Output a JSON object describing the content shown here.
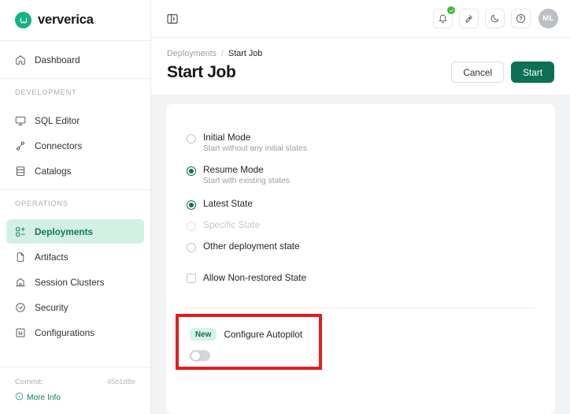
{
  "brand": {
    "name": "ververica",
    "logo_icon": "ververica-logo-icon"
  },
  "sidebar": {
    "top_items": [
      {
        "label": "Dashboard",
        "icon": "home-icon"
      }
    ],
    "sections": [
      {
        "label": "DEVELOPMENT",
        "items": [
          {
            "label": "SQL Editor",
            "icon": "sql-editor-icon"
          },
          {
            "label": "Connectors",
            "icon": "connectors-icon"
          },
          {
            "label": "Catalogs",
            "icon": "catalogs-icon"
          }
        ]
      },
      {
        "label": "OPERATIONS",
        "items": [
          {
            "label": "Deployments",
            "icon": "deployments-icon",
            "active": true
          },
          {
            "label": "Artifacts",
            "icon": "artifacts-icon"
          },
          {
            "label": "Session Clusters",
            "icon": "session-clusters-icon"
          },
          {
            "label": "Security",
            "icon": "security-icon"
          },
          {
            "label": "Configurations",
            "icon": "configurations-icon"
          }
        ]
      }
    ],
    "footer": {
      "commit_label": "Commit:",
      "commit_hash": "45b1d8e",
      "more_info_label": "More Info",
      "more_info_icon": "info-circle-icon"
    }
  },
  "topbar": {
    "collapse_icon": "sidebar-collapse-icon",
    "actions": [
      {
        "name": "notifications",
        "icon": "bell-icon",
        "badge": "check"
      },
      {
        "name": "integrations",
        "icon": "plug-icon"
      },
      {
        "name": "theme-toggle",
        "icon": "moon-icon"
      },
      {
        "name": "help",
        "icon": "question-circle-icon"
      }
    ],
    "avatar_initials": "ML"
  },
  "page": {
    "breadcrumb": {
      "parent": "Deployments",
      "separator": "/",
      "current": "Start Job"
    },
    "title": "Start Job",
    "cancel_label": "Cancel",
    "start_label": "Start"
  },
  "form": {
    "modes": [
      {
        "label": "Initial Mode",
        "desc": "Start without any initial states",
        "selected": false
      },
      {
        "label": "Resume Mode",
        "desc": "Start with existing states",
        "selected": true
      }
    ],
    "state_options": [
      {
        "label": "Latest State",
        "selected": true,
        "disabled": false
      },
      {
        "label": "Specific State",
        "selected": false,
        "disabled": true
      },
      {
        "label": "Other deployment state",
        "selected": false,
        "disabled": false
      }
    ],
    "allow_non_restored": {
      "label": "Allow Non-restored State",
      "checked": false
    },
    "autopilot": {
      "badge": "New",
      "label": "Configure Autopilot",
      "enabled": false
    }
  },
  "colors": {
    "accent": "#0d7155",
    "accent_soft": "#d3f0e4",
    "brand_green": "#13b183",
    "highlight_box": "#e01f1f",
    "badge_green": "#3cbc3c"
  }
}
